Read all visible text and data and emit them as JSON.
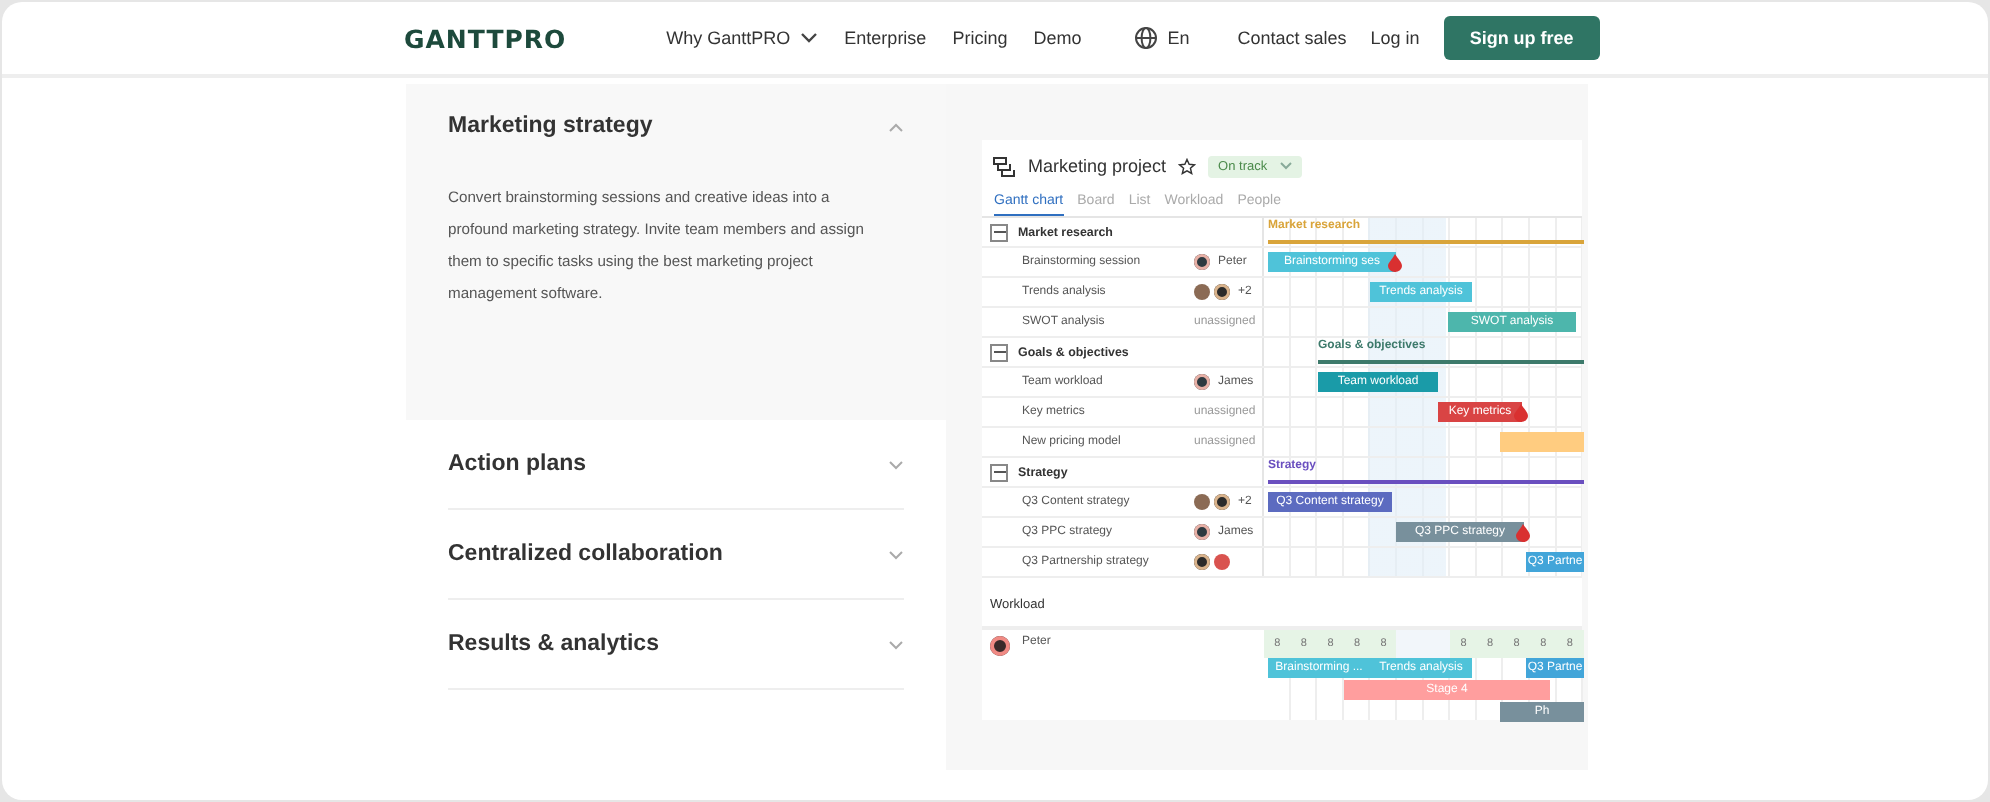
{
  "nav": {
    "logo": "GANTTPRO",
    "links": [
      {
        "label": "Why GanttPRO",
        "dropdown": true
      },
      {
        "label": "Enterprise",
        "dropdown": false
      },
      {
        "label": "Pricing",
        "dropdown": false
      },
      {
        "label": "Demo",
        "dropdown": false
      }
    ],
    "language": "En",
    "contact": "Contact sales",
    "login": "Log in",
    "cta": "Sign up free"
  },
  "accordion": [
    {
      "title": "Marketing strategy",
      "expanded": true,
      "body": "Convert brainstorming sessions and creative ideas into a profound marketing strategy. Invite team members and assign them to specific tasks using the best marketing project management software."
    },
    {
      "title": "Action plans",
      "expanded": false
    },
    {
      "title": "Centralized collaboration",
      "expanded": false
    },
    {
      "title": "Results & analytics",
      "expanded": false
    }
  ],
  "app": {
    "title": "Marketing project",
    "status": "On track",
    "tabs": [
      {
        "label": "Gantt chart",
        "selected": true
      },
      {
        "label": "Board",
        "selected": false
      },
      {
        "label": "List",
        "selected": false
      },
      {
        "label": "Workload",
        "selected": false
      },
      {
        "label": "People",
        "selected": false
      }
    ],
    "groups": [
      {
        "name": "Market research",
        "bar_label": "Market research",
        "expanded": true,
        "color": "#d9a43a",
        "tasks": [
          {
            "name": "Brainstorming session",
            "kind": "named",
            "assignee": "Peter",
            "bar_label": "Brainstorming ses",
            "color": "#4fc3d9",
            "overdue": true
          },
          {
            "name": "Trends analysis",
            "kind": "group",
            "assignee": "+2",
            "bar_label": "Trends analysis",
            "color": "#4fc3d9",
            "overdue": false
          },
          {
            "name": "SWOT analysis",
            "kind": "unassigned",
            "assignee": "unassigned",
            "bar_label": "SWOT analysis",
            "color": "#4db6ac",
            "overdue": false
          }
        ]
      },
      {
        "name": "Goals & objectives",
        "bar_label": "Goals & objectives",
        "expanded": true,
        "color": "#3d7a6b",
        "tasks": [
          {
            "name": "Team workload",
            "kind": "named",
            "assignee": "James",
            "bar_label": "Team workload",
            "color": "#1a9ba8",
            "overdue": false
          },
          {
            "name": "Key metrics",
            "kind": "unassigned",
            "assignee": "unassigned",
            "bar_label": "Key metrics",
            "color": "#d94444",
            "overdue": true
          },
          {
            "name": "New pricing model",
            "kind": "unassigned",
            "assignee": "unassigned",
            "color": "#ffcc80",
            "overdue": false
          }
        ]
      },
      {
        "name": "Strategy",
        "bar_label": "Strategy",
        "expanded": true,
        "color": "#6a4fbf",
        "tasks": [
          {
            "name": "Q3 Content strategy",
            "kind": "group",
            "assignee": "+2",
            "bar_label": "Q3 Content strategy",
            "color": "#5c6bc0",
            "overdue": false
          },
          {
            "name": "Q3 PPC strategy",
            "kind": "named",
            "assignee": "James",
            "bar_label": "Q3 PPC strategy",
            "color": "#78909c",
            "overdue": true
          },
          {
            "name": "Q3 Partnership strategy",
            "kind": "pair",
            "bar_label": "Q3 Partne",
            "color": "#42a5d9",
            "overdue": false
          }
        ]
      }
    ],
    "workload": {
      "label": "Workload",
      "person": "Peter",
      "hours": [
        {
          "value": "8",
          "busy": true
        },
        {
          "value": "8",
          "busy": true
        },
        {
          "value": "8",
          "busy": true
        },
        {
          "value": "8",
          "busy": true
        },
        {
          "value": "8",
          "busy": true
        },
        {
          "busy": false
        },
        {
          "busy": false
        },
        {
          "value": "8",
          "busy": true
        },
        {
          "value": "8",
          "busy": true
        },
        {
          "value": "8",
          "busy": true
        },
        {
          "value": "8",
          "busy": true
        },
        {
          "value": "8",
          "busy": true
        }
      ],
      "bars": [
        {
          "label": "Brainstorming ...",
          "color": "#4fc3d9"
        },
        {
          "label": "Trends analysis",
          "color": "#4fc3d9"
        },
        {
          "label": "Q3 Partne",
          "color": "#42a5d9"
        },
        {
          "label": "Stage 4",
          "color": "#ff9e9e"
        },
        {
          "label": "Ph",
          "color": "#78909c"
        }
      ]
    }
  }
}
